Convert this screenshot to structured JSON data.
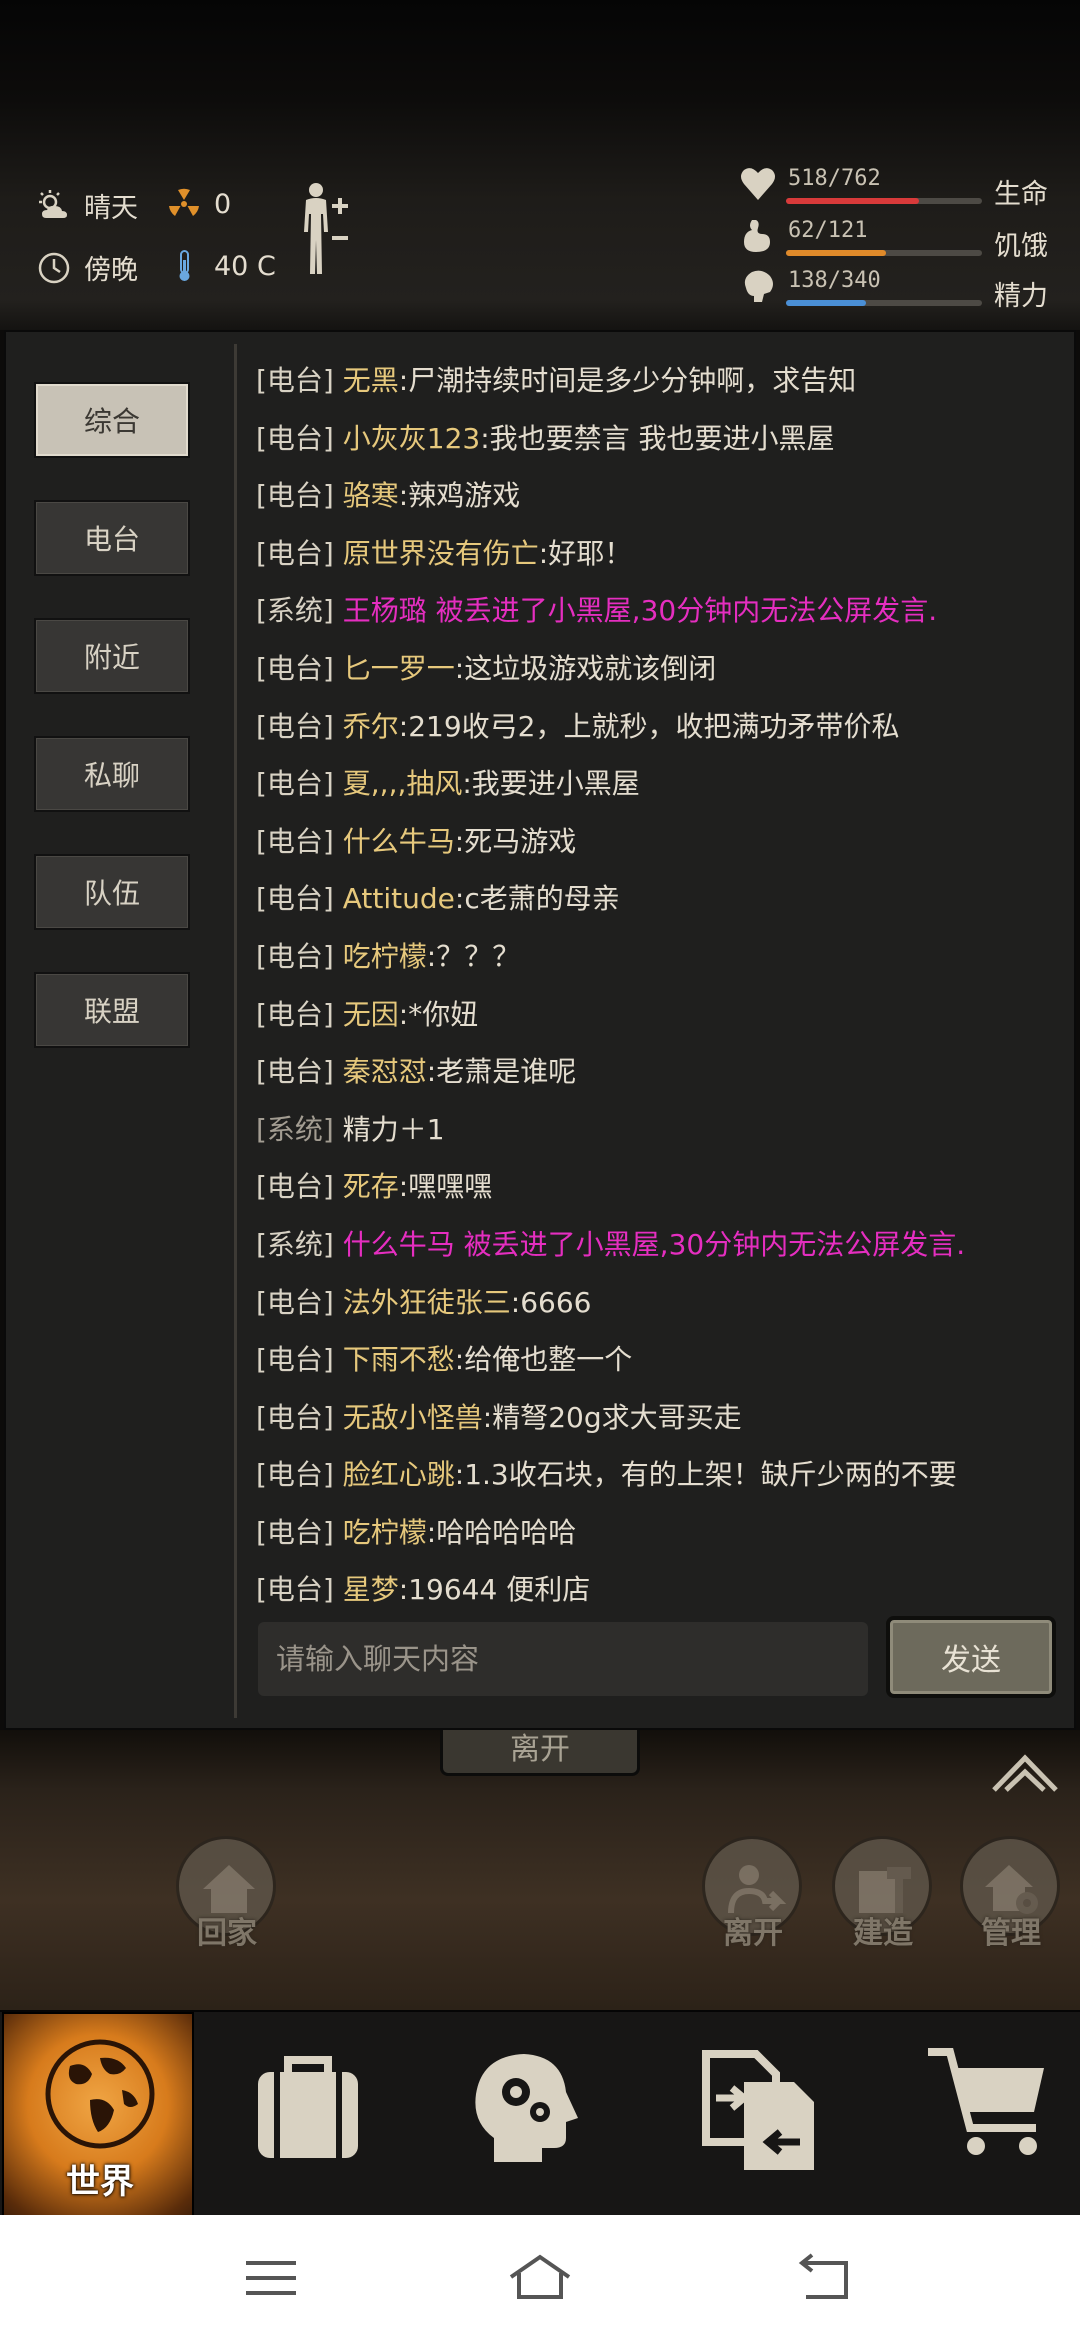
{
  "status": {
    "weather": "晴天",
    "radiation": "0",
    "time_of_day": "傍晚",
    "temperature": "40 C"
  },
  "vitals": [
    {
      "name": "生命",
      "value": "518/762",
      "current": 518,
      "max": 762,
      "color": "#d83a3a",
      "icon": "heart-icon"
    },
    {
      "name": "饥饿",
      "value": "62/121",
      "current": 62,
      "max": 121,
      "color": "#e08a2a",
      "icon": "stomach-icon"
    },
    {
      "name": "精力",
      "value": "138/340",
      "current": 138,
      "max": 340,
      "color": "#4a8fd6",
      "icon": "brain-icon"
    }
  ],
  "chat": {
    "channels": [
      {
        "label": "综合",
        "active": true
      },
      {
        "label": "电台",
        "active": false
      },
      {
        "label": "附近",
        "active": false
      },
      {
        "label": "私聊",
        "active": false
      },
      {
        "label": "队伍",
        "active": false
      },
      {
        "label": "联盟",
        "active": false
      }
    ],
    "messages": [
      {
        "channel": "[电台]",
        "name": "无黑",
        "text": ":尸潮持续时间是多少分钟啊，求告知"
      },
      {
        "channel": "[电台]",
        "name": "小灰灰123",
        "text": ":我也要禁言 我也要进小黑屋"
      },
      {
        "channel": "[电台]",
        "name": "骆寒",
        "text": ":辣鸡游戏"
      },
      {
        "channel": "[电台]",
        "name": "原世界没有伤亡",
        "text": ":好耶！"
      },
      {
        "channel": "[系统]",
        "name": "王杨璐",
        "text": " 被丢进了小黑屋,30分钟内无法公屏发言.",
        "style": "pink"
      },
      {
        "channel": "[电台]",
        "name": "匕一罗一",
        "text": ":这垃圾游戏就该倒闭"
      },
      {
        "channel": "[电台]",
        "name": "乔尔",
        "text": ":219收弓2，上就秒，收把满功矛带价私"
      },
      {
        "channel": "[电台]",
        "name": "夏,,,,抽风",
        "text": ":我要进小黑屋"
      },
      {
        "channel": "[电台]",
        "name": "什么牛马",
        "text": ":死马游戏"
      },
      {
        "channel": "[电台]",
        "name": "Attitude",
        "text": ":c老萧的母亲"
      },
      {
        "channel": "[电台]",
        "name": "吃柠檬",
        "text": ":？？？"
      },
      {
        "channel": "[电台]",
        "name": "无因",
        "text": ":*你妞"
      },
      {
        "channel": "[电台]",
        "name": "秦怼怼",
        "text": ":老萧是谁呢"
      },
      {
        "channel": "[系统]",
        "name": "",
        "text": "精力＋1",
        "style": "sys"
      },
      {
        "channel": "[电台]",
        "name": "死存",
        "text": ":嘿嘿嘿"
      },
      {
        "channel": "[系统]",
        "name": "什么牛马",
        "text": " 被丢进了小黑屋,30分钟内无法公屏发言.",
        "style": "pink"
      },
      {
        "channel": "[电台]",
        "name": "法外狂徒张三",
        "text": ":6666"
      },
      {
        "channel": "[电台]",
        "name": "下雨不愁",
        "text": ":给俺也整一个"
      },
      {
        "channel": "[电台]",
        "name": "无敌小怪兽",
        "text": ":精弩20g求大哥买走"
      },
      {
        "channel": "[电台]",
        "name": "脸红心跳",
        "text": ":1.3收石块，有的上架！缺斤少两的不要"
      },
      {
        "channel": "[电台]",
        "name": "吃柠檬",
        "text": ":哈哈哈哈哈"
      },
      {
        "channel": "[电台]",
        "name": "星梦",
        "text": ":19644 便利店"
      }
    ],
    "input_placeholder": "请输入聊天内容",
    "send_label": "发送"
  },
  "scene": {
    "leave_hint": "离开",
    "buttons": [
      {
        "label": "回家",
        "icon": "home-icon"
      },
      {
        "label": "离开",
        "icon": "exit-icon"
      },
      {
        "label": "建造",
        "icon": "build-icon"
      },
      {
        "label": "管理",
        "icon": "manage-icon"
      }
    ]
  },
  "nav": {
    "world_label": "世界"
  }
}
